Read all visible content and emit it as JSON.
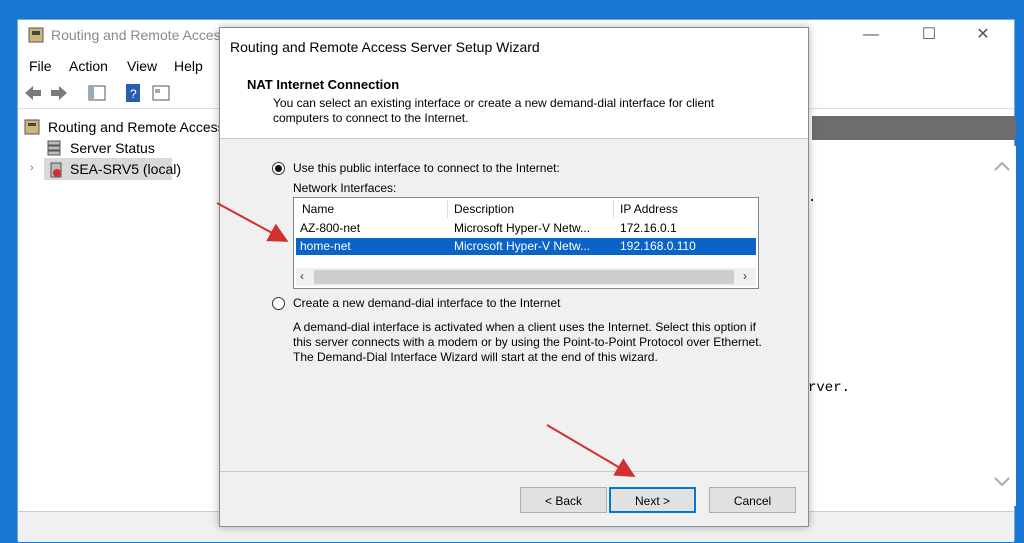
{
  "background_window": {
    "title": "Routing and Remote Access",
    "menu": [
      "File",
      "Action",
      "View",
      "Help"
    ],
    "tree": {
      "root": "Routing and Remote Access",
      "items": [
        "Server Status",
        "SEA-SRV5 (local)"
      ]
    },
    "right_fragments": [
      ".",
      "rver."
    ],
    "window_controls": {
      "minimize": "—",
      "maximize": "☐",
      "close": "✕"
    }
  },
  "wizard": {
    "title": "Routing and Remote Access Server Setup Wizard",
    "header_title": "NAT Internet Connection",
    "header_description": "You can select an existing interface or create a new demand-dial interface for client computers to connect to the Internet.",
    "option_public": "Use this public interface to connect to the Internet:",
    "interfaces_label": "Network Interfaces:",
    "columns": [
      "Name",
      "Description",
      "IP Address"
    ],
    "interfaces": [
      {
        "name": "AZ-800-net",
        "description": "Microsoft Hyper-V Netw...",
        "ip": "172.16.0.1"
      },
      {
        "name": "home-net",
        "description": "Microsoft Hyper-V Netw...",
        "ip": "192.168.0.110"
      }
    ],
    "selected_interface": "home-net",
    "option_demand_dial": "Create a new demand-dial interface to the Internet",
    "demand_dial_description": "A demand-dial interface is activated when a client uses the Internet. Select this option if this server connects with a modem or by using the Point-to-Point Protocol over Ethernet. The Demand-Dial Interface Wizard will start at the end of this wizard.",
    "buttons": {
      "back": "< Back",
      "next": "Next >",
      "cancel": "Cancel"
    }
  },
  "colors": {
    "accent": "#0078d7",
    "selection": "#0a64c8",
    "annotation_arrow": "#d32f2f"
  }
}
